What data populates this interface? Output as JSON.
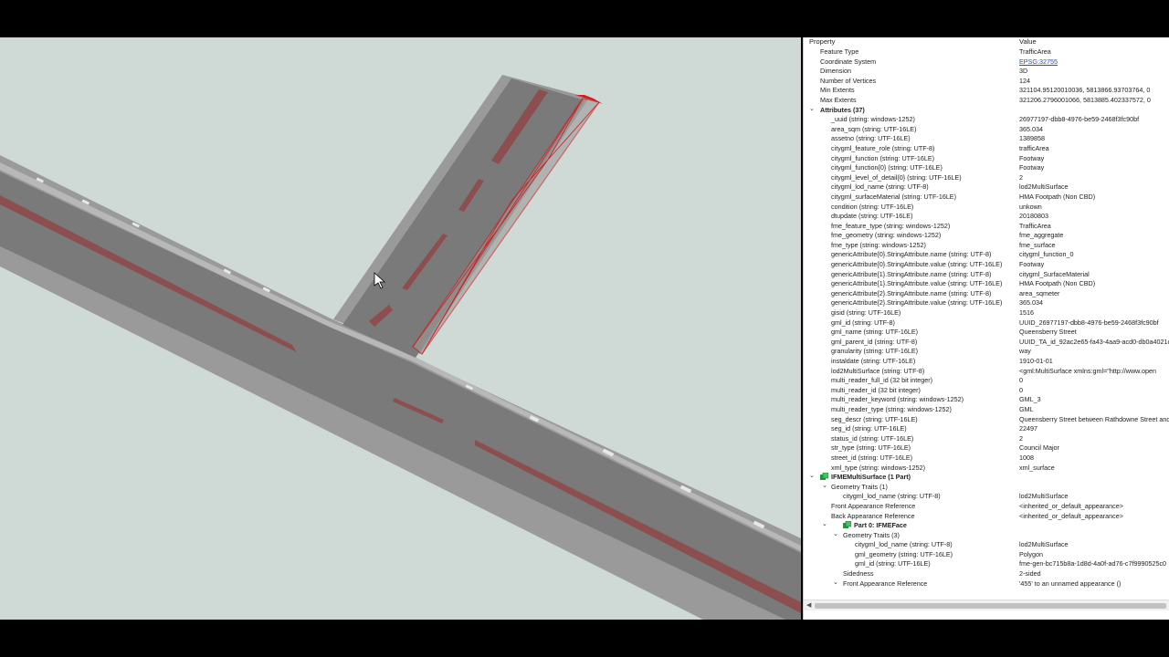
{
  "colors": {
    "ground": "#cfd9d6",
    "road": "#7b7b7b",
    "footpath": "#969696",
    "kerb": "#b3b3b3",
    "marking": "#8e4a4a",
    "selection": "#d21f1f"
  },
  "panel": {
    "header_property": "Property",
    "header_value": "Value",
    "rows": [
      {
        "level": 1,
        "name": "Feature Type",
        "value": "TrafficArea"
      },
      {
        "level": 1,
        "name": "Coordinate System",
        "value": "EPSG:32755",
        "link": true
      },
      {
        "level": 1,
        "name": "Dimension",
        "value": "3D"
      },
      {
        "level": 1,
        "name": "Number of Vertices",
        "value": "124"
      },
      {
        "level": 1,
        "name": "Min Extents",
        "value": "321104.95120010036, 5813866.93703764, 0"
      },
      {
        "level": 1,
        "name": "Max Extents",
        "value": "321206.2796001066, 5813885.402337572, 0"
      },
      {
        "level": 0,
        "name": "Attributes (37)",
        "toggle": "⌄",
        "bold": true
      },
      {
        "level": 2,
        "name": "_uuid (string: windows-1252)",
        "value": "26977197-dbb8-4976-be59-2468f3fc90bf"
      },
      {
        "level": 2,
        "name": "area_sqm (string: UTF-16LE)",
        "value": "365.034"
      },
      {
        "level": 2,
        "name": "assetno (string: UTF-16LE)",
        "value": "1389858"
      },
      {
        "level": 2,
        "name": "citygml_feature_role (string: UTF-8)",
        "value": "trafficArea"
      },
      {
        "level": 2,
        "name": "citygml_function (string: UTF-16LE)",
        "value": "Footway"
      },
      {
        "level": 2,
        "name": "citygml_function{0} (string: UTF-16LE)",
        "value": "Footway"
      },
      {
        "level": 2,
        "name": "citygml_level_of_detail{0} (string: UTF-16LE)",
        "value": "2"
      },
      {
        "level": 2,
        "name": "citygml_lod_name (string: UTF-8)",
        "value": "lod2MultiSurface"
      },
      {
        "level": 2,
        "name": "citygml_surfaceMaterial (string: UTF-16LE)",
        "value": "HMA Footpath (Non CBD)"
      },
      {
        "level": 2,
        "name": "condition (string: UTF-16LE)",
        "value": "unkown"
      },
      {
        "level": 2,
        "name": "dtupdate (string: UTF-16LE)",
        "value": "20180803"
      },
      {
        "level": 2,
        "name": "fme_feature_type (string: windows-1252)",
        "value": "TrafficArea"
      },
      {
        "level": 2,
        "name": "fme_geometry (string: windows-1252)",
        "value": "fme_aggregate"
      },
      {
        "level": 2,
        "name": "fme_type (string: windows-1252)",
        "value": "fme_surface"
      },
      {
        "level": 2,
        "name": "genericAttribute{0}.StringAttribute.name (string: UTF-8)",
        "value": "citygml_function_0"
      },
      {
        "level": 2,
        "name": "genericAttribute{0}.StringAttribute.value (string: UTF-16LE)",
        "value": "Footway"
      },
      {
        "level": 2,
        "name": "genericAttribute{1}.StringAttribute.name (string: UTF-8)",
        "value": "citygml_SurfaceMaterial"
      },
      {
        "level": 2,
        "name": "genericAttribute{1}.StringAttribute.value (string: UTF-16LE)",
        "value": "HMA Footpath (Non CBD)"
      },
      {
        "level": 2,
        "name": "genericAttribute{2}.StringAttribute.name (string: UTF-8)",
        "value": "area_sqmeter"
      },
      {
        "level": 2,
        "name": "genericAttribute{2}.StringAttribute.value (string: UTF-16LE)",
        "value": "365.034"
      },
      {
        "level": 2,
        "name": "gisid (string: UTF-16LE)",
        "value": "1516"
      },
      {
        "level": 2,
        "name": "gml_id (string: UTF-8)",
        "value": "UUID_26977197-dbb8-4976-be59-2468f3fc90bf"
      },
      {
        "level": 2,
        "name": "gml_name (string: UTF-16LE)",
        "value": "Queensberry Street"
      },
      {
        "level": 2,
        "name": "gml_parent_id (string: UTF-8)",
        "value": "UUID_TA_id_92ac2e65-fa43-4aa9-acd0-db0a4021c3"
      },
      {
        "level": 2,
        "name": "granularity (string: UTF-16LE)",
        "value": "way"
      },
      {
        "level": 2,
        "name": "instaldate (string: UTF-16LE)",
        "value": "1910-01-01"
      },
      {
        "level": 2,
        "name": "lod2MultiSurface (string: UTF-8)",
        "value": "<gml:MultiSurface xmlns:gml=\"http://www.open"
      },
      {
        "level": 2,
        "name": "multi_reader_full_id (32 bit integer)",
        "value": "0"
      },
      {
        "level": 2,
        "name": "multi_reader_id (32 bit integer)",
        "value": "0"
      },
      {
        "level": 2,
        "name": "multi_reader_keyword (string: windows-1252)",
        "value": "GML_3"
      },
      {
        "level": 2,
        "name": "multi_reader_type (string: windows-1252)",
        "value": "GML"
      },
      {
        "level": 2,
        "name": "seg_descr (string: UTF-16LE)",
        "value": "Queensberry Street between Rathdowne Street and"
      },
      {
        "level": 2,
        "name": "seg_id (string: UTF-16LE)",
        "value": "22497"
      },
      {
        "level": 2,
        "name": "status_id (string: UTF-16LE)",
        "value": "2"
      },
      {
        "level": 2,
        "name": "str_type (string: UTF-16LE)",
        "value": "Council Major"
      },
      {
        "level": 2,
        "name": "street_id (string: UTF-16LE)",
        "value": "1008"
      },
      {
        "level": 2,
        "name": "xml_type (string: windows-1252)",
        "value": "xml_surface"
      },
      {
        "level": 0,
        "name": "IFMEMultiSurface (1 Part)",
        "toggle": "⌄",
        "bold": true,
        "icon": "multisurface-icon"
      },
      {
        "level": 2,
        "name": "Geometry Traits (1)",
        "toggle": "⌄",
        "toggleLevel": 1
      },
      {
        "level": 3,
        "name": "citygml_lod_name (string: UTF-8)",
        "value": "lod2MultiSurface"
      },
      {
        "level": 2,
        "name": "Front Appearance Reference",
        "value": "<inherited_or_default_appearance>"
      },
      {
        "level": 2,
        "name": "Back Appearance Reference",
        "value": "<inherited_or_default_appearance>"
      },
      {
        "level": 3,
        "name": "Part 0: IFMEFace",
        "toggle": "⌄",
        "toggleLevel": 1,
        "bold": true,
        "icon": "face-icon"
      },
      {
        "level": 3,
        "name": "Geometry Traits (3)",
        "toggle": "⌄",
        "toggleLevel": 2
      },
      {
        "level": 4,
        "name": "citygml_lod_name (string: UTF-8)",
        "value": "lod2MultiSurface"
      },
      {
        "level": 4,
        "name": "gml_geometry (string: UTF-16LE)",
        "value": "Polygon"
      },
      {
        "level": 4,
        "name": "gml_id (string: UTF-16LE)",
        "value": "fme-gen-bc715b8a-1d8d-4a0f-ad76-c7f9990525c0"
      },
      {
        "level": 3,
        "name": "Sidedness",
        "value": "2-sided"
      },
      {
        "level": 3,
        "name": "Front Appearance Reference",
        "toggle": "⌄",
        "toggleLevel": 2,
        "value": "'455' to an unnamed appearance ()"
      }
    ]
  }
}
